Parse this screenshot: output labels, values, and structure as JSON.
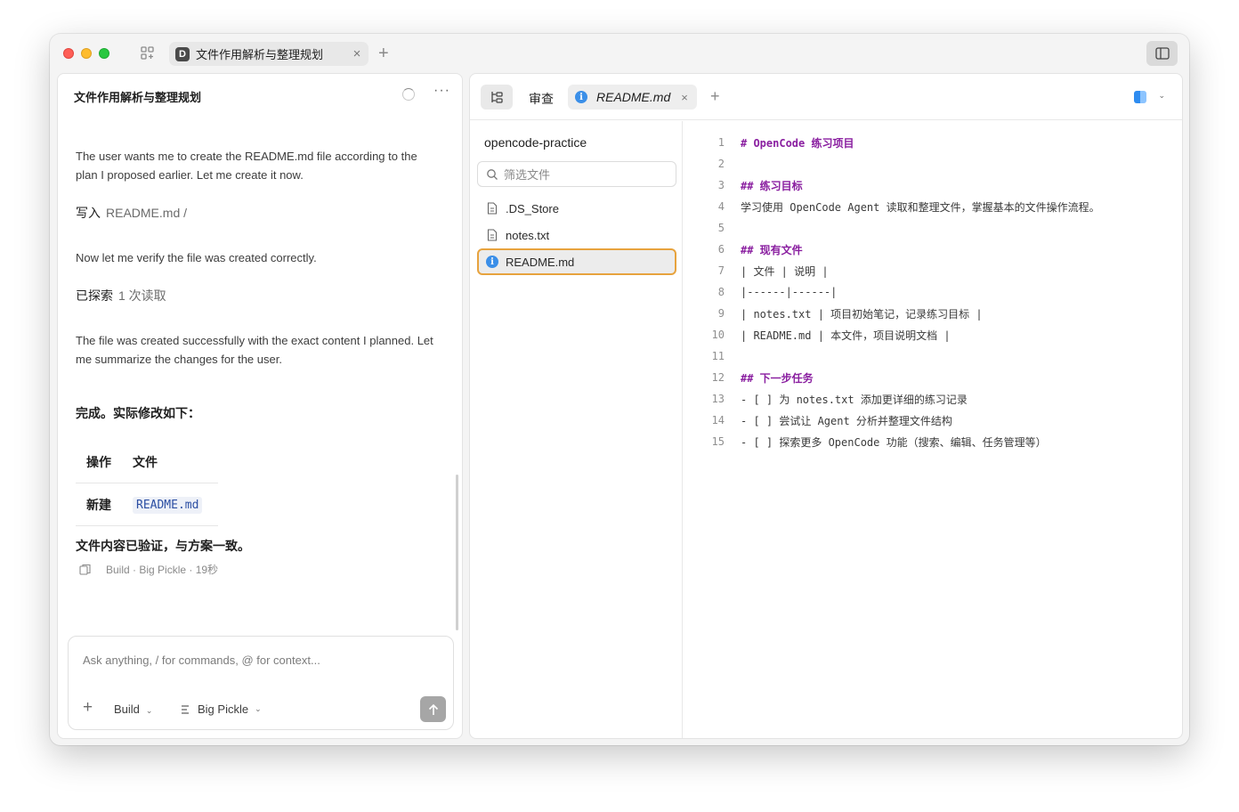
{
  "window": {
    "tab_badge": "D",
    "tab_title": "文件作用解析与整理规划",
    "tab_close": "×",
    "new_tab": "+"
  },
  "chat": {
    "header_title": "文件作用解析与整理规划",
    "more_label": "···",
    "messages": {
      "m1": "The user wants me to create the README.md file according to the plan I proposed earlier. Let me create it now.",
      "tool1_action": "写入",
      "tool1_target": "README.md  /",
      "m2": "Now let me verify the file was created correctly.",
      "tool2_action": "已探索",
      "tool2_target": "1 次读取",
      "m3": "The file was created successfully with the exact content I planned. Let me summarize the changes for the user.",
      "done": "完成。实际修改如下：",
      "table_headers": [
        "操作",
        "文件"
      ],
      "table_rows": [
        [
          "新建",
          "README.md"
        ]
      ],
      "verified": "文件内容已验证，与方案一致。",
      "meta": "Build · Big Pickle · 19秒"
    },
    "composer": {
      "placeholder": "Ask anything, / for commands, @ for context...",
      "plus": "+",
      "agent": "Build",
      "model": "Big Pickle"
    }
  },
  "files": {
    "review_tab": "审查",
    "open_tab": "README.md",
    "open_tab_close": "×",
    "new_tab": "+",
    "project": "opencode-practice",
    "filter_placeholder": "筛选文件",
    "items": [
      {
        "name": ".DS_Store",
        "icon": "file-icon"
      },
      {
        "name": "notes.txt",
        "icon": "file-icon"
      },
      {
        "name": "README.md",
        "icon": "info-icon"
      }
    ],
    "lines": [
      {
        "n": "1",
        "text": "# OpenCode 练习项目",
        "heading": true
      },
      {
        "n": "2",
        "text": "",
        "heading": false
      },
      {
        "n": "3",
        "text": "## 练习目标",
        "heading": true
      },
      {
        "n": "4",
        "text": "学习使用 OpenCode Agent 读取和整理文件，掌握基本的文件操作流程。",
        "heading": false
      },
      {
        "n": "5",
        "text": "",
        "heading": false
      },
      {
        "n": "6",
        "text": "## 现有文件",
        "heading": true
      },
      {
        "n": "7",
        "text": "| 文件 | 说明 |",
        "heading": false
      },
      {
        "n": "8",
        "text": "|------|------|",
        "heading": false
      },
      {
        "n": "9",
        "text": "| notes.txt | 项目初始笔记，记录练习目标 |",
        "heading": false
      },
      {
        "n": "10",
        "text": "| README.md | 本文件，项目说明文档 |",
        "heading": false
      },
      {
        "n": "11",
        "text": "",
        "heading": false
      },
      {
        "n": "12",
        "text": "## 下一步任务",
        "heading": true
      },
      {
        "n": "13",
        "text": "- [ ] 为 notes.txt 添加更详细的练习记录",
        "heading": false
      },
      {
        "n": "14",
        "text": "- [ ] 尝试让 Agent 分析并整理文件结构",
        "heading": false
      },
      {
        "n": "15",
        "text": "- [ ] 探索更多 OpenCode 功能（搜索、编辑、任务管理等）",
        "heading": false
      }
    ]
  },
  "colors": {
    "heading": "#8a1fa0",
    "selection_border": "#e7a33e",
    "info": "#3b8fe8"
  }
}
